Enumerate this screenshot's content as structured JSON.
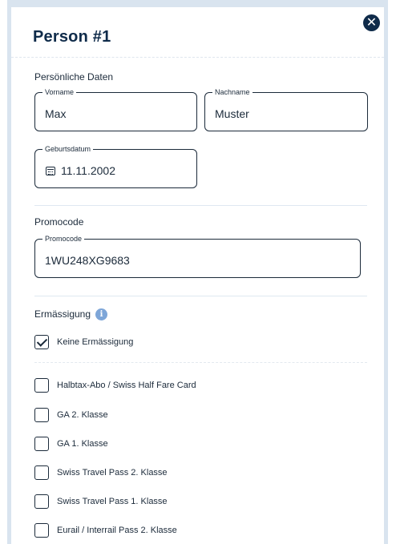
{
  "dialog": {
    "title": "Person #1",
    "close_icon": "close-circle-icon"
  },
  "personal": {
    "section_label": "Persönliche Daten",
    "firstname": {
      "label": "Vorname",
      "value": "Max"
    },
    "lastname": {
      "label": "Nachname",
      "value": "Muster"
    },
    "birthdate": {
      "label": "Geburtsdatum",
      "value": "11.11.2002",
      "icon": "calendar-icon"
    }
  },
  "promo": {
    "section_label": "Promocode",
    "field_label": "Promocode",
    "value": "1WU248XG9683"
  },
  "discount": {
    "section_label": "Ermässigung",
    "info_icon": "info-icon",
    "none_option": {
      "label": "Keine Ermässigung",
      "checked": true
    },
    "options": [
      {
        "label": "Halbtax-Abo / Swiss Half Fare Card",
        "checked": false
      },
      {
        "label": "GA 2. Klasse",
        "checked": false
      },
      {
        "label": "GA 1. Klasse",
        "checked": false
      },
      {
        "label": "Swiss Travel Pass 2. Klasse",
        "checked": false
      },
      {
        "label": "Swiss Travel Pass 1. Klasse",
        "checked": false
      },
      {
        "label": "Eurail / Interrail Pass 2. Klasse",
        "checked": false
      }
    ]
  }
}
